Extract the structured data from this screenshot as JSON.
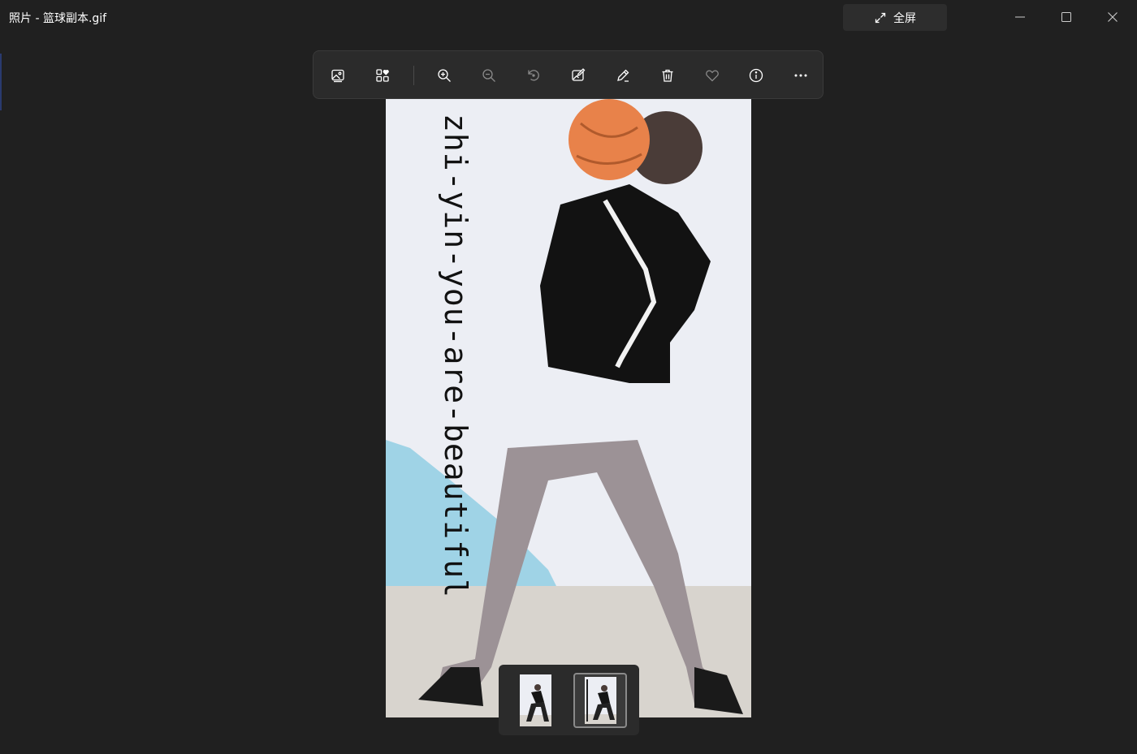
{
  "window": {
    "title": "照片 - 篮球副本.gif",
    "fullscreen_label": "全屏"
  },
  "toolbar": {
    "items": [
      {
        "name": "view-image-icon",
        "label": "View image"
      },
      {
        "name": "collections-icon",
        "label": "Collections"
      },
      {
        "name": "zoom-in-icon",
        "label": "Zoom in"
      },
      {
        "name": "zoom-out-icon",
        "label": "Zoom out"
      },
      {
        "name": "rotate-icon",
        "label": "Rotate"
      },
      {
        "name": "edit-image-icon",
        "label": "Edit image"
      },
      {
        "name": "draw-icon",
        "label": "Draw"
      },
      {
        "name": "delete-icon",
        "label": "Delete"
      },
      {
        "name": "favorite-icon",
        "label": "Favorite"
      },
      {
        "name": "info-icon",
        "label": "File info"
      },
      {
        "name": "more-icon",
        "label": "See more"
      }
    ]
  },
  "photo": {
    "caption": "zhi-yin-you-are-beautiful"
  },
  "filmstrip": {
    "thumbnails": [
      {
        "name": "thumbnail-1",
        "selected": false
      },
      {
        "name": "thumbnail-2",
        "selected": true
      }
    ]
  },
  "colors": {
    "background": "#202020",
    "toolbar": "#2b2b2b",
    "accent": "#ffffff"
  }
}
